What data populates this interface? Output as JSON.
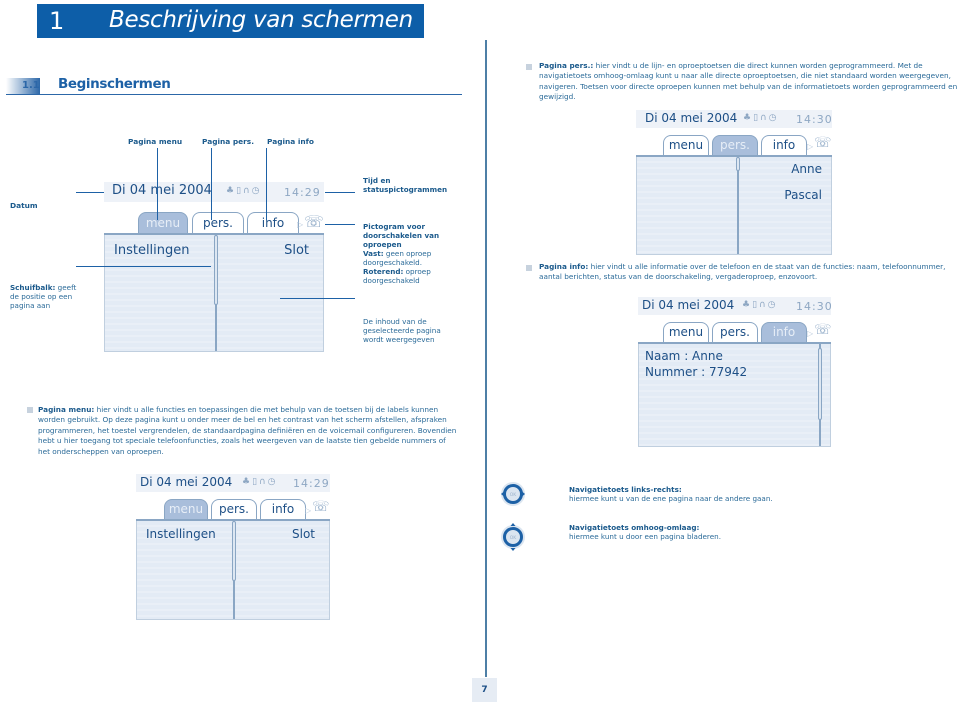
{
  "chapter": {
    "number": "1",
    "title": "Beschrijving van schermen"
  },
  "section": {
    "number": "1.1",
    "title": "Beginschermen"
  },
  "callouts": {
    "pagina_menu": "Pagina menu",
    "pagina_pers": "Pagina pers.",
    "pagina_info": "Pagina info",
    "datum": "Datum",
    "schuifbalk_bold": "Schuifbalk:",
    "schuifbalk_text": "geeft de positie op een pagina aan",
    "tijd": "Tijd en statuspictogrammen",
    "pictogram_title": "Pictogram voor doorschakelen van oproepen",
    "vast_bold": "Vast:",
    "vast_text": "geen oproep doorgeschakeld.",
    "roterend_bold": "Roterend:",
    "roterend_text": "oproep doorgeschakeld",
    "inhoud": "De inhoud van de geselecteerde pagina wordt weergegeven"
  },
  "main_phone": {
    "date": "Di 04 mei 2004",
    "time": "14:29",
    "status_icons": [
      "bell-icon",
      "lock-icon",
      "headset-icon",
      "clock-icon"
    ],
    "tabs": [
      {
        "label": "menu",
        "active": true
      },
      {
        "label": "pers.",
        "active": false
      },
      {
        "label": "info",
        "active": false
      }
    ],
    "left_item": "Instellingen",
    "right_item": "Slot"
  },
  "menu_phone": {
    "date": "Di 04 mei 2004",
    "time": "14:29",
    "tabs": [
      {
        "label": "menu",
        "active": true
      },
      {
        "label": "pers.",
        "active": false
      },
      {
        "label": "info",
        "active": false
      }
    ],
    "left_item": "Instellingen",
    "right_item": "Slot"
  },
  "pers_phone": {
    "date": "Di 04 mei 2004",
    "time": "14:30",
    "tabs": [
      {
        "label": "menu",
        "active": false
      },
      {
        "label": "pers.",
        "active": true
      },
      {
        "label": "info",
        "active": false
      }
    ],
    "right_items": [
      "Anne",
      "Pascal"
    ]
  },
  "info_phone": {
    "date": "Di 04 mei 2004",
    "time": "14:30",
    "tabs": [
      {
        "label": "menu",
        "active": false
      },
      {
        "label": "pers.",
        "active": false
      },
      {
        "label": "info",
        "active": true
      }
    ],
    "lines": [
      "Naam : Anne",
      "Nummer : 77942"
    ]
  },
  "paragraphs": {
    "menu_bold": "Pagina menu:",
    "menu_text": "hier vindt u alle functies en toepassingen die met behulp van de toetsen bij de labels kunnen worden gebruikt. Op deze pagina kunt u onder meer de bel en het contrast van het scherm afstellen, afspraken programmeren, het toestel vergrendelen, de standaardpagina definiëren en de voicemail configureren. Bovendien hebt u hier toegang tot speciale telefoonfuncties, zoals het weergeven van de laatste tien gebelde nummers of het onderscheppen van oproepen.",
    "pers_bold": "Pagina pers.:",
    "pers_text": "hier vindt u de lijn- en oproeptoetsen die direct kunnen worden geprogrammeerd. Met de navigatietoets omhoog-omlaag kunt u naar alle directe oproeptoetsen, die niet standaard worden weergegeven, navigeren. Toetsen voor directe oproepen kunnen met behulp van de informatietoets worden geprogrammeerd en gewijzigd.",
    "info_bold": "Pagina info:",
    "info_text": "hier vindt u alle informatie over de telefoon en de staat van de functies: naam, telefoonnummer, aantal berichten, status van de doorschakeling, vergaderoproep, enzovoort."
  },
  "nav_keys": [
    {
      "title": "Navigatietoets links-rechts:",
      "text": "hiermee kunt u van de ene pagina naar de andere gaan.",
      "key_label": "OK"
    },
    {
      "title": "Navigatietoets omhoog-omlaag:",
      "text": "hiermee kunt u door een pagina bladeren.",
      "key_label": "OK"
    }
  ],
  "page_number": "7",
  "colors": {
    "brand_blue": "#0d5ea8",
    "text_blue": "#1f5b8a",
    "active_tab": "#a9bedb"
  }
}
